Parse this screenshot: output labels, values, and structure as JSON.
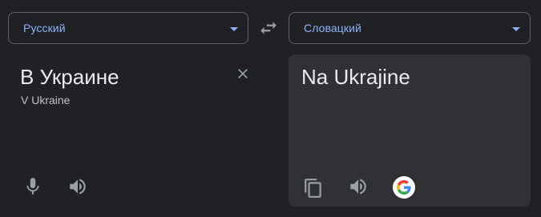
{
  "source_language": {
    "label": "Русский"
  },
  "target_language": {
    "label": "Словацкий"
  },
  "source": {
    "text": "В Украине",
    "transliteration": "V Ukraine"
  },
  "target": {
    "text": "Na Ukrajine"
  },
  "icons": {
    "swap": "swap-arrows-icon",
    "clear": "close-icon",
    "mic": "microphone-icon",
    "speak_source": "speaker-icon",
    "copy": "copy-icon",
    "speak_target": "speaker-icon",
    "google": "google-logo-icon"
  },
  "colors": {
    "background": "#202124",
    "panel": "#303134",
    "accent": "#8ab4f8",
    "text": "#e8eaed",
    "muted": "#bdc1c6",
    "icon": "#9aa0a6"
  }
}
